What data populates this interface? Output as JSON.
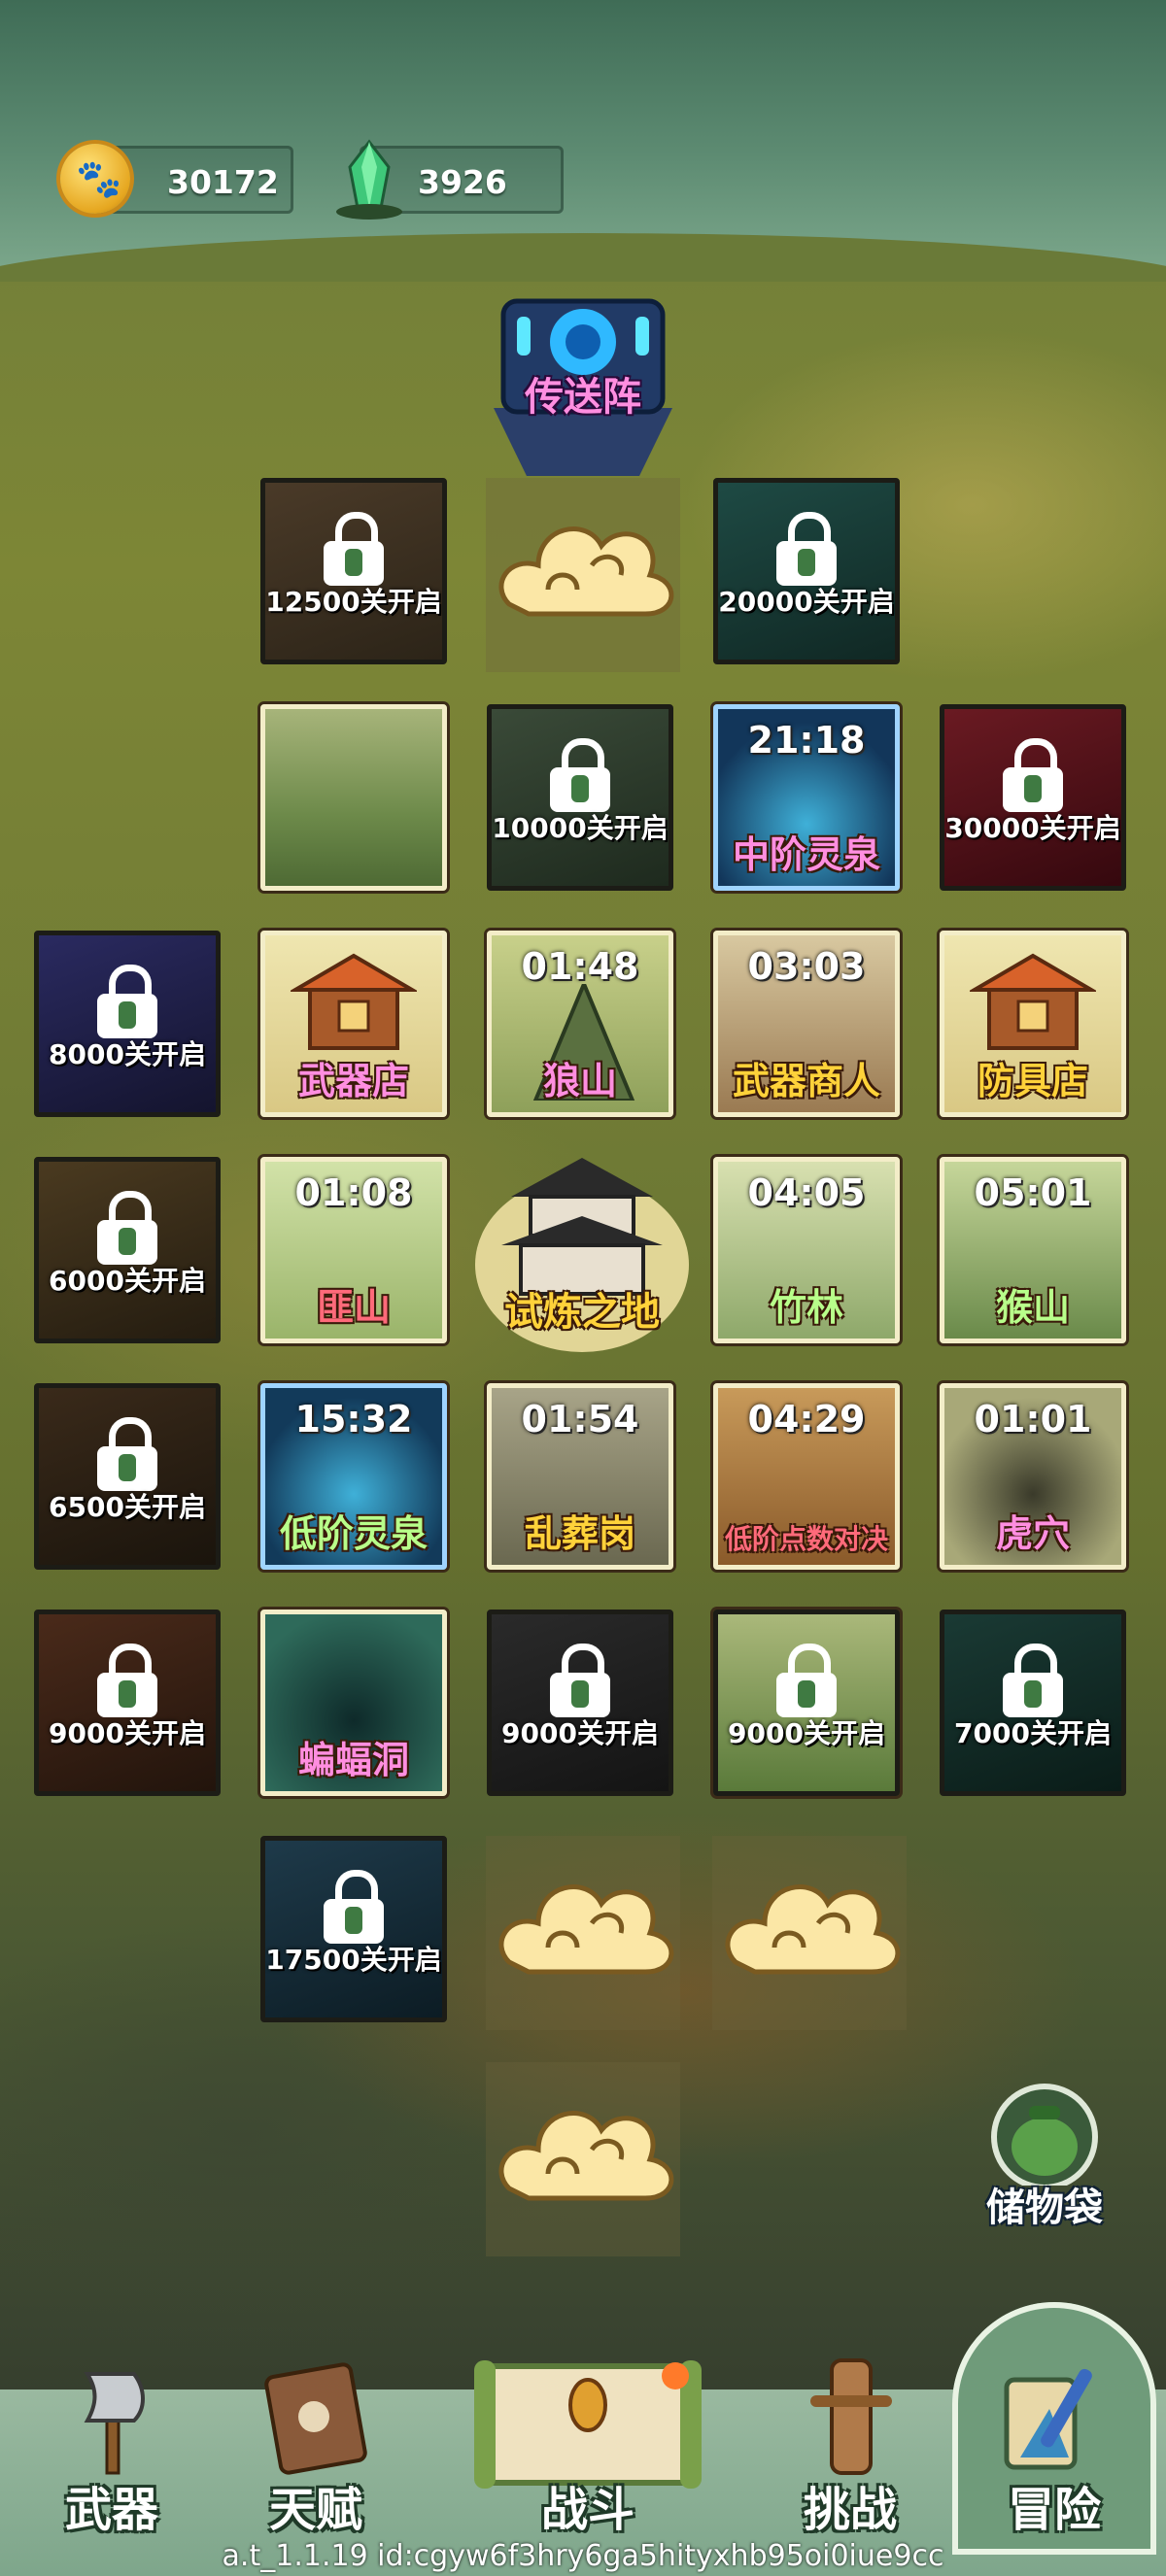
{
  "resources": {
    "coins": "30172",
    "gems": "3926"
  },
  "portal": {
    "label": "传送阵"
  },
  "tiles": {
    "r1c1": {
      "text": "12500关开启"
    },
    "r1c3": {
      "text": "20000关开启"
    },
    "r2c2": {
      "text": "10000关开启"
    },
    "r2c3": {
      "timer": "21:18",
      "label": "中阶灵泉"
    },
    "r2c4": {
      "text": "30000关开启"
    },
    "r3c0": {
      "text": "8000关开启"
    },
    "r3c1": {
      "label": "武器店"
    },
    "r3c2": {
      "timer": "01:48",
      "label": "狼山"
    },
    "r3c3": {
      "timer": "03:03",
      "label": "武器商人"
    },
    "r3c4": {
      "label": "防具店"
    },
    "r4c0": {
      "text": "6000关开启"
    },
    "r4c1": {
      "timer": "01:08",
      "label": "匪山"
    },
    "r4c3": {
      "timer": "04:05",
      "label": "竹林"
    },
    "r4c4": {
      "timer": "05:01",
      "label": "猴山"
    },
    "r5c0": {
      "text": "6500关开启"
    },
    "r5c1": {
      "timer": "15:32",
      "label": "低阶灵泉"
    },
    "r5c2": {
      "timer": "01:54",
      "label": "乱葬岗"
    },
    "r5c3": {
      "timer": "04:29",
      "label": "低阶点数对决"
    },
    "r5c4": {
      "timer": "01:01",
      "label": "虎穴"
    },
    "r6c0": {
      "text": "9000关开启"
    },
    "r6c1": {
      "label": "蝙蝠洞"
    },
    "r6c2": {
      "text": "9000关开启"
    },
    "r6c3": {
      "text": "9000关开启"
    },
    "r6c4": {
      "text": "7000关开启"
    },
    "r7c1": {
      "text": "17500关开启"
    }
  },
  "trial": {
    "label": "试炼之地"
  },
  "storage": {
    "label": "储物袋"
  },
  "nav": {
    "weapons": "武器",
    "talent": "天赋",
    "battle": "战斗",
    "challenge": "挑战",
    "adventure": "冒险"
  },
  "version": "a.t_1.1.19 id:cgyw6f3hry6ga5hityxhb95oi0iue9cc",
  "colors": {
    "pink_label": "#ff8ee0",
    "yellow_label": "#ffd23a",
    "green_label": "#b8ff8a",
    "lock_green": "#3f7a42"
  }
}
